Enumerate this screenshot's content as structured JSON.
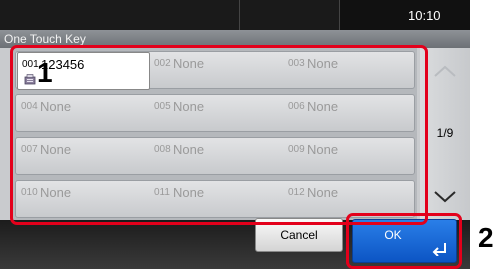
{
  "status": {
    "time": "10:10"
  },
  "title": "One Touch Key",
  "keys": [
    {
      "num": "001",
      "name": "123456",
      "selected": true
    },
    {
      "num": "002",
      "name": "None"
    },
    {
      "num": "003",
      "name": "None"
    },
    {
      "num": "004",
      "name": "None"
    },
    {
      "num": "005",
      "name": "None"
    },
    {
      "num": "006",
      "name": "None"
    },
    {
      "num": "007",
      "name": "None"
    },
    {
      "num": "008",
      "name": "None"
    },
    {
      "num": "009",
      "name": "None"
    },
    {
      "num": "010",
      "name": "None"
    },
    {
      "num": "011",
      "name": "None"
    },
    {
      "num": "012",
      "name": "None"
    }
  ],
  "pager": {
    "page": "1/9"
  },
  "buttons": {
    "cancel": "Cancel",
    "ok": "OK"
  },
  "callouts": {
    "one": "1",
    "two": "2"
  },
  "colors": {
    "highlight": "#e3001b",
    "ok": "#1f6fdc"
  }
}
